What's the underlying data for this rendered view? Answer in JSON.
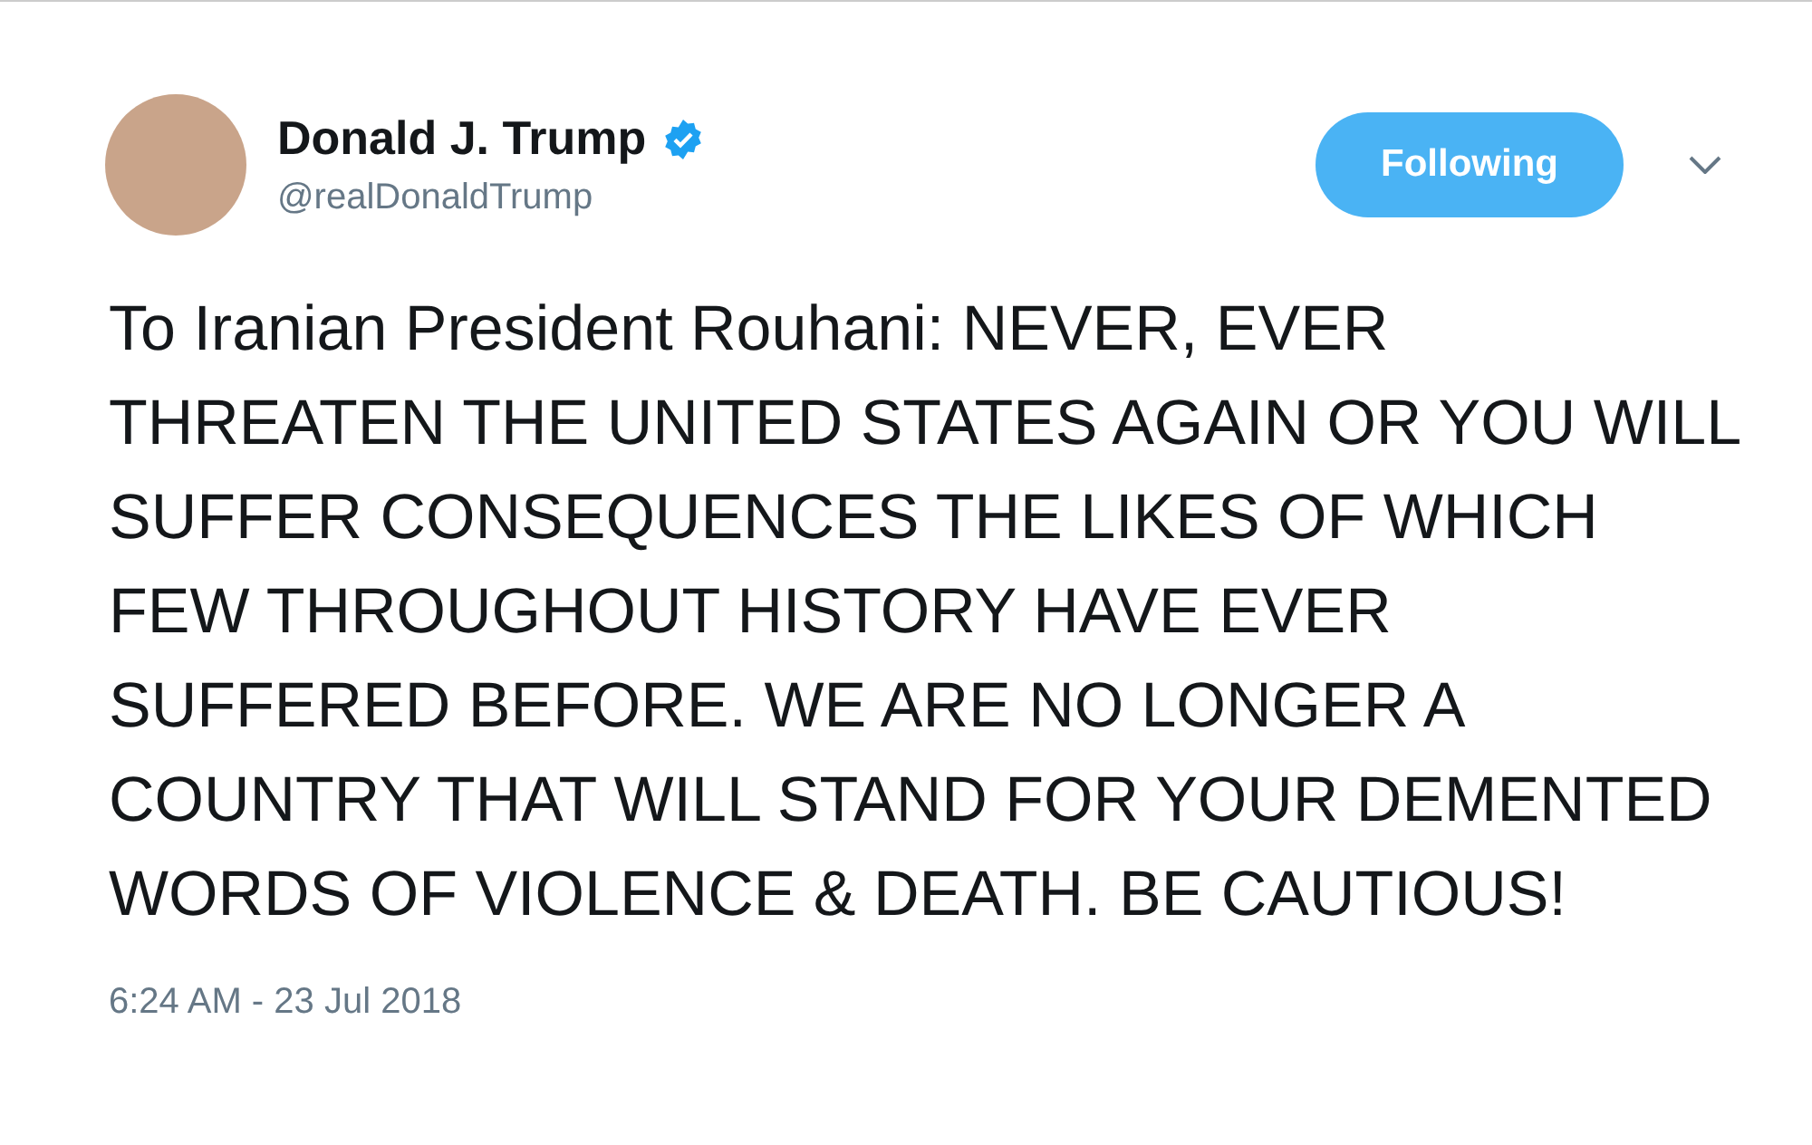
{
  "author": {
    "name": "Donald J. Trump",
    "handle": "@realDonaldTrump",
    "verified": true
  },
  "follow_button": {
    "label": "Following",
    "selected": true
  },
  "tweet": {
    "text": "To Iranian President Rouhani: NEVER, EVER THREATEN THE UNITED STATES AGAIN OR YOU WILL SUFFER CONSEQUENCES THE LIKES OF WHICH FEW THROUGHOUT HISTORY HAVE EVER SUFFERED BEFORE. WE ARE NO LONGER A COUNTRY THAT WILL STAND FOR YOUR DEMENTED WORDS OF VIOLENCE & DEATH. BE CAUTIOUS!",
    "timestamp": "6:24 AM - 23 Jul 2018"
  }
}
